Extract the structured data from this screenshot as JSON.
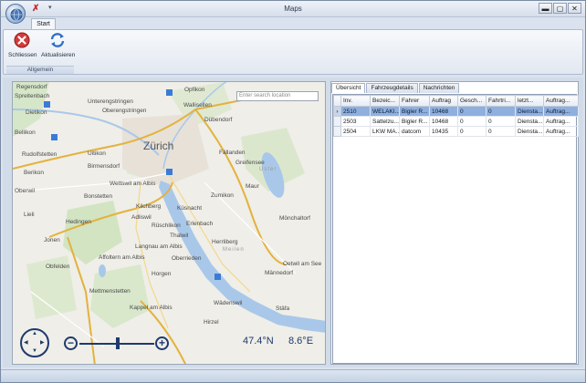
{
  "window": {
    "title": "Maps"
  },
  "qat": {
    "close_glyph": "✗",
    "more_glyph": "▾"
  },
  "window_buttons": {
    "minimize": "▬",
    "maximize": "▢",
    "close": "✕"
  },
  "ribbon": {
    "tabs": [
      {
        "label": "Start"
      }
    ],
    "groups": [
      {
        "label": "Allgemein",
        "buttons": [
          {
            "label": "Schliessen",
            "icon": "close-circle-icon"
          },
          {
            "label": "Aktualisieren",
            "icon": "refresh-icon"
          }
        ]
      }
    ]
  },
  "map": {
    "search_placeholder": "Enter search location",
    "coord_lat": "47.4°N",
    "coord_lon": "8.6°E",
    "labels": [
      "Regensdorf",
      "Opfikon",
      "Spreitenbach",
      "Unterengstringen",
      "Wallisellen",
      "Dietikon",
      "Oberengstringen",
      "Dübendorf",
      "Bellikon",
      "Zürich",
      "Rudolfstetten",
      "Uitikon",
      "Fällanden",
      "Birmensdorf",
      "Greifensee",
      "Berikon",
      "Oberwil",
      "Wettswil am Albis",
      "Kilchberg",
      "Zumikon",
      "Maur",
      "Bonstetten",
      "Adliswil",
      "Küsnacht",
      "Lieli",
      "Hedingen",
      "Rüschlikon",
      "Erlenbach",
      "Mönchaltorf",
      "Jonen",
      "Langnau am Albis",
      "Thalwil",
      "Affoltern am Albis",
      "Herrliberg",
      "Oberrieden",
      "Meilen",
      "Obfelden",
      "Horgen",
      "Männedorf",
      "Mettmenstetten",
      "Wädenswil",
      "Kappel am Albis",
      "Hirzel",
      "Uster",
      "Stäfa",
      "Oetwil am See"
    ]
  },
  "panel": {
    "tabs": [
      {
        "label": "Übersicht"
      },
      {
        "label": "Fahrzeugdetails"
      },
      {
        "label": "Nachrichten"
      }
    ],
    "columns": [
      "Inv.",
      "Bezeic...",
      "Fahrer",
      "Auftrag",
      "Gesch...",
      "Fahrtri...",
      "letzt...",
      "Auftrag..."
    ],
    "rows": [
      {
        "selected": true,
        "indicator": "›",
        "cells": [
          "2510",
          "WELAKI...",
          "Bigler R...",
          "10468",
          "0",
          "0",
          "Diensta...",
          "Auftrag..."
        ]
      },
      {
        "selected": false,
        "indicator": "",
        "cells": [
          "2503",
          "Sattelzu...",
          "Bigler R...",
          "10468",
          "0",
          "0",
          "Diensta...",
          "Auftrag..."
        ]
      },
      {
        "selected": false,
        "indicator": "",
        "cells": [
          "2504",
          "LKW MA...",
          "datcom",
          "10435",
          "0",
          "0",
          "Diensta...",
          "Auftrag..."
        ]
      }
    ]
  }
}
